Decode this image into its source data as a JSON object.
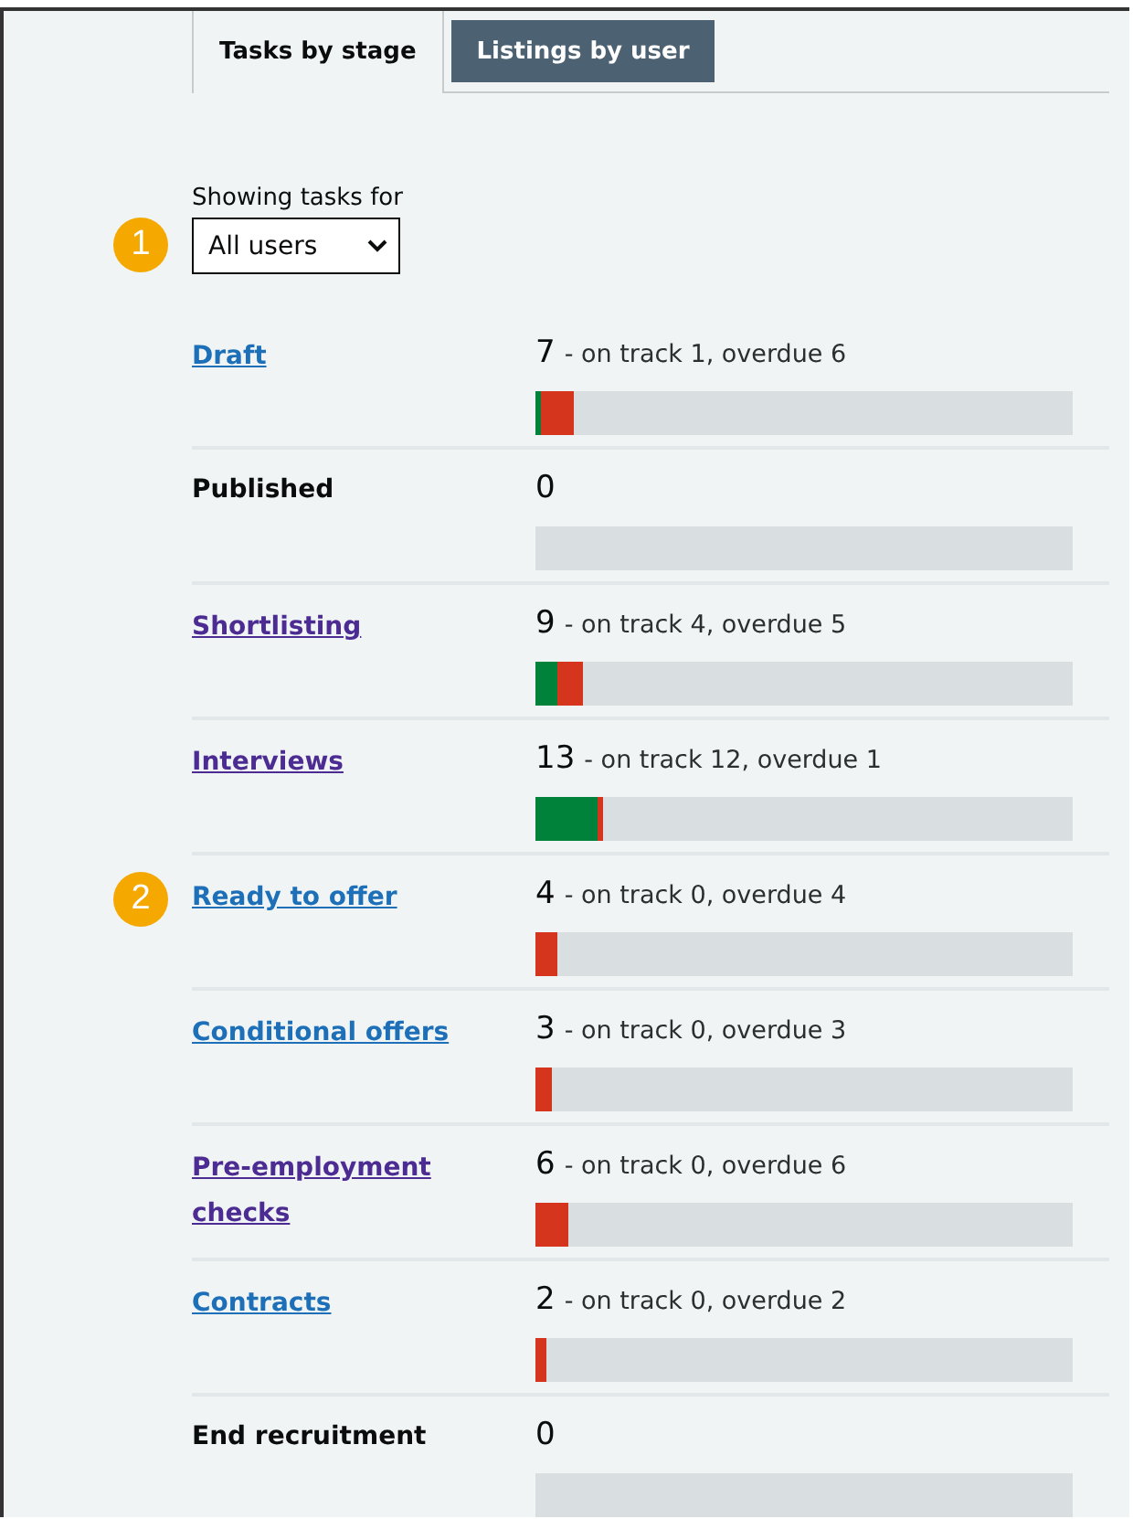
{
  "tabs": [
    {
      "label": "Tasks by stage",
      "selected": true
    },
    {
      "label": "Listings by user",
      "selected": false
    }
  ],
  "filter": {
    "label": "Showing tasks for",
    "value": "All users",
    "badge": "1"
  },
  "stages": [
    {
      "name": "Draft",
      "kind": "link",
      "visited": false,
      "count": "7",
      "detail": "- on track 1, overdue 6",
      "level": 0.07,
      "on_track": {
        "level": 0.01
      }
    },
    {
      "name": "Published",
      "kind": "text",
      "count": "0"
    },
    {
      "name": "Shortlisting",
      "kind": "link",
      "visited": true,
      "count": "9",
      "detail": "- on track 4, overdue 5",
      "level": 0.09,
      "on_track": {
        "level": 0.04
      }
    },
    {
      "name": "Interviews",
      "kind": "link",
      "visited": true,
      "count": "13",
      "detail": "- on track 12, overdue 1",
      "level": 0.125,
      "on_track": {
        "level": 0.115
      }
    },
    {
      "name": "Ready to offer",
      "kind": "link",
      "visited": false,
      "badge": "2",
      "count": "4",
      "detail": "- on track 0, overdue 4",
      "level": 0.04
    },
    {
      "name": "Conditional offers",
      "kind": "link",
      "visited": false,
      "count": "3",
      "detail": "- on track 0, overdue 3",
      "level": 0.03
    },
    {
      "name": "Pre-employment checks",
      "kind": "link",
      "visited": true,
      "count": "6",
      "detail": "- on track 0, overdue 6",
      "level": 0.06
    },
    {
      "name": "Contracts",
      "kind": "link",
      "visited": false,
      "count": "2",
      "detail": "- on track 0, overdue 2",
      "level": 0.02
    },
    {
      "name": "End recruitment",
      "kind": "text",
      "count": "0"
    }
  ]
}
